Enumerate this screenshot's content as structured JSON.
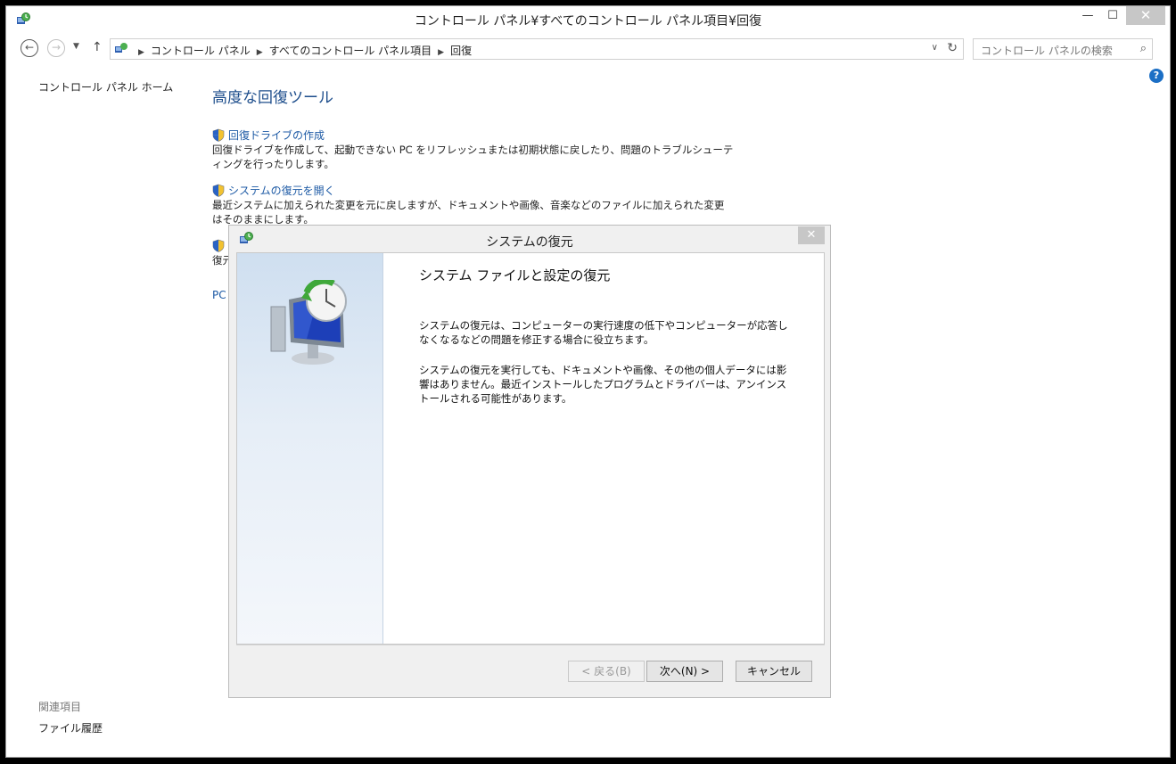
{
  "window": {
    "title": "コントロール パネル¥すべてのコントロール パネル項目¥回復",
    "minimize": "—",
    "maximize": "☐",
    "close": "✕"
  },
  "address": {
    "crumbs": [
      "コントロール パネル",
      "すべてのコントロール パネル項目",
      "回復"
    ],
    "search_placeholder": "コントロール パネルの検索"
  },
  "nav": {
    "back": "←",
    "forward": "→",
    "recent": "▼",
    "up": "↑",
    "dropdown": "∨",
    "refresh": "↻",
    "search_icon": "⌕"
  },
  "help": "?",
  "sidebar": {
    "home": "コントロール パネル ホーム",
    "related_heading": "関連項目",
    "related_links": [
      "ファイル履歴"
    ]
  },
  "main": {
    "heading": "高度な回復ツール",
    "items": [
      {
        "link": "回復ドライブの作成",
        "desc": "回復ドライブを作成して、起動できない PC をリフレッシュまたは初期状態に戻したり、問題のトラブルシューティングを行ったりします。"
      },
      {
        "link": "システムの復元を開く",
        "desc": "最近システムに加えられた変更を元に戻しますが、ドキュメントや画像、音楽などのファイルに加えられた変更はそのままにします。"
      },
      {
        "link": "",
        "desc": "復元"
      },
      {
        "link": "PC",
        "desc": ""
      }
    ]
  },
  "dialog": {
    "title": "システムの復元",
    "close": "✕",
    "heading": "システム ファイルと設定の復元",
    "paragraphs": [
      "システムの復元は、コンピューターの実行速度の低下やコンピューターが応答しなくなるなどの問題を修正する場合に役立ちます。",
      "システムの復元を実行しても、ドキュメントや画像、その他の個人データには影響はありません。最近インストールしたプログラムとドライバーは、アンインストールされる可能性があります。"
    ],
    "buttons": {
      "back": "< 戻る(B)",
      "next": "次へ(N) >",
      "cancel": "キャンセル"
    }
  }
}
